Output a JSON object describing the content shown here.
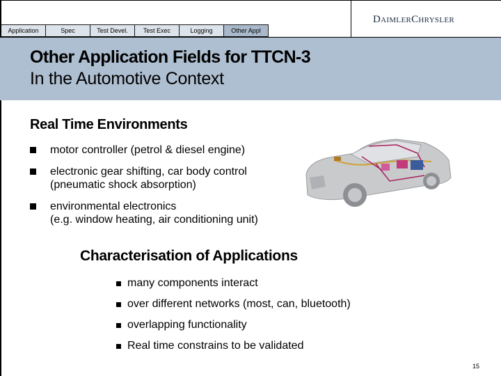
{
  "nav": {
    "tabs": [
      {
        "label": "Application",
        "active": false
      },
      {
        "label": "Spec",
        "active": false
      },
      {
        "label": "Test Devel.",
        "active": false
      },
      {
        "label": "Test Exec",
        "active": false
      },
      {
        "label": "Logging",
        "active": false
      },
      {
        "label": "Other Appl",
        "active": true
      }
    ]
  },
  "logo": {
    "text_part1": "Daimler",
    "text_part2": "Chrysler"
  },
  "header": {
    "title": "Other Application Fields for TTCN-3",
    "subtitle": "In the Automotive Context"
  },
  "sections": [
    {
      "heading": "Real Time Environments",
      "items": [
        {
          "line1": "motor controller (petrol & diesel engine)",
          "line2": ""
        },
        {
          "line1": "electronic gear shifting, car body control",
          "line2": "(pneumatic shock absorption)"
        },
        {
          "line1": "environmental electronics",
          "line2": "(e.g. window heating, air conditioning unit)"
        }
      ]
    },
    {
      "heading": "Characterisation of Applications",
      "items": [
        {
          "line1": "many components interact"
        },
        {
          "line1": "over different networks (most, can, bluetooth)"
        },
        {
          "line1": "overlapping functionality"
        },
        {
          "line1": "Real time constrains to be validated"
        }
      ]
    }
  ],
  "image": {
    "icon": "car-wiring-diagram-image"
  },
  "footer": {
    "page_number": "15"
  },
  "colors": {
    "header_band": "#aebfd1",
    "tab_bg": "#dde3ea",
    "tab_active": "#a9b9cb",
    "logo": "#1c2a44"
  }
}
